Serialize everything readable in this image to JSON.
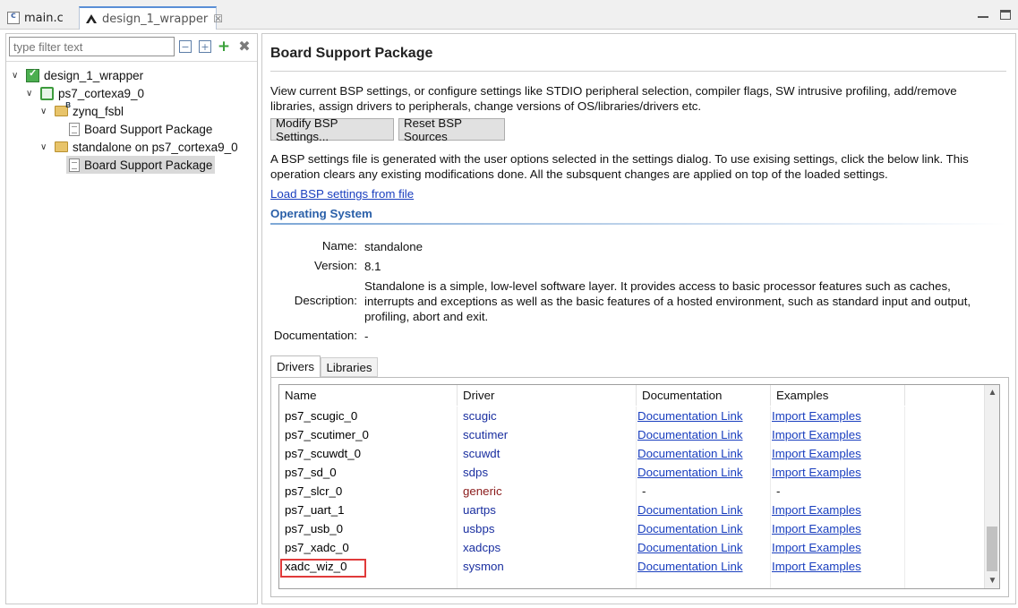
{
  "editor_tabs": [
    {
      "label": "main.c",
      "icon": "c-file-icon"
    },
    {
      "label": "design_1_wrapper",
      "icon": "xilinx-logo-icon",
      "close": "☒"
    }
  ],
  "explorer": {
    "filter_placeholder": "type filter text",
    "tree": [
      {
        "label": "design_1_wrapper",
        "icon": "platform-project-icon",
        "expanded": true,
        "level": 0
      },
      {
        "label": "ps7_cortexa9_0",
        "icon": "processor-chip-icon",
        "expanded": true,
        "level": 1
      },
      {
        "label": "zynq_fsbl",
        "icon": "bsp-folder-icon",
        "expanded": true,
        "level": 2
      },
      {
        "label": "Board Support Package",
        "icon": "document-icon",
        "level": 3
      },
      {
        "label": "standalone on ps7_cortexa9_0",
        "icon": "folder-icon",
        "expanded": true,
        "level": 2
      },
      {
        "label": "Board Support Package",
        "icon": "document-icon",
        "level": 3,
        "selected": true
      }
    ]
  },
  "main": {
    "title": "Board Support Package",
    "intro": "View current BSP settings, or configure settings like STDIO peripheral selection, compiler flags, SW intrusive profiling, add/remove libraries, assign drivers to peripherals, change versions of OS/libraries/drivers etc.",
    "modify_button": "Modify BSP Settings...",
    "reset_button": "Reset BSP Sources",
    "note": "A BSP settings file is generated with the user options selected in the settings dialog. To use exising settings, click the below link. This operation clears any existing modifications done. All the subsquent changes are applied on top of the loaded settings.",
    "load_link": "Load BSP settings from file",
    "os_section": "Operating System",
    "os": {
      "name_label": "Name:",
      "name": "standalone",
      "version_label": "Version:",
      "version": "8.1",
      "description_label": "Description:",
      "description": "Standalone is a simple, low-level software layer. It provides access to basic processor features such as caches, interrupts and exceptions as well as the basic features of a hosted environment, such as standard input and output, profiling, abort and exit.",
      "documentation_label": "Documentation:",
      "documentation": "-"
    },
    "sub_tabs": {
      "drivers": "Drivers",
      "libraries": "Libraries"
    },
    "table": {
      "columns": [
        "Name",
        "Driver",
        "Documentation",
        "Examples"
      ],
      "rows": [
        {
          "name": "ps7_scugic_0",
          "driver": "scugic",
          "doc": "Documentation Link",
          "examples": "Import Examples"
        },
        {
          "name": "ps7_scutimer_0",
          "driver": "scutimer",
          "doc": "Documentation Link",
          "examples": "Import Examples"
        },
        {
          "name": "ps7_scuwdt_0",
          "driver": "scuwdt",
          "doc": "Documentation Link",
          "examples": "Import Examples"
        },
        {
          "name": "ps7_sd_0",
          "driver": "sdps",
          "doc": "Documentation Link",
          "examples": "Import Examples"
        },
        {
          "name": "ps7_slcr_0",
          "driver": "generic",
          "doc": "-",
          "examples": "-"
        },
        {
          "name": "ps7_uart_1",
          "driver": "uartps",
          "doc": "Documentation Link",
          "examples": "Import Examples"
        },
        {
          "name": "ps7_usb_0",
          "driver": "usbps",
          "doc": "Documentation Link",
          "examples": "Import Examples"
        },
        {
          "name": "ps7_xadc_0",
          "driver": "xadcps",
          "doc": "Documentation Link",
          "examples": "Import Examples"
        },
        {
          "name": "xadc_wiz_0",
          "driver": "sysmon",
          "doc": "Documentation Link",
          "examples": "Import Examples",
          "highlighted": true
        }
      ]
    }
  },
  "colors": {
    "link": "#1a3fbf",
    "driver_text": "#1a2fa0",
    "generic_driver_text": "#8a1a1a",
    "section_title": "#2a5fa8",
    "highlight_box": "#e03a3a",
    "selection": "#d9d9d9"
  }
}
